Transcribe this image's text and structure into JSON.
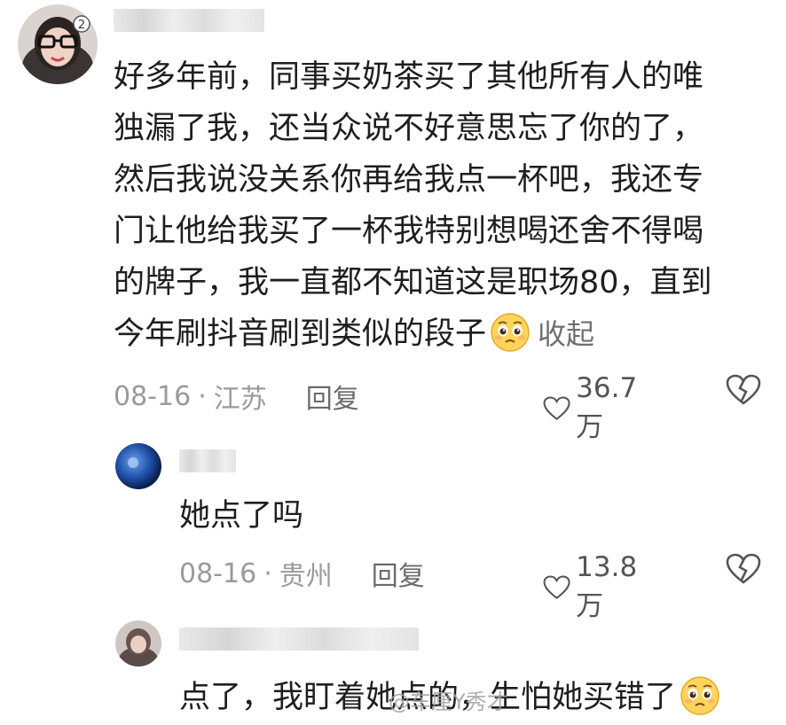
{
  "comments": [
    {
      "lines": [
        "好多年前，同事买奶茶买了其他所有人的唯",
        "独漏了我，还当众说不好意思忘了你的了，",
        "然后我说没关系你再给我点一杯吧，我还专",
        "门让他给我买了一杯我特别想喝还舍不得喝",
        "的牌子，我一直都不知道这是职场80，直到",
        "今年刷抖音刷到类似的段子"
      ],
      "emoji": "pleading-face-emoji",
      "collapse_label": "收起",
      "date": "08-16",
      "location": "江苏",
      "reply_label": "回复",
      "like_count": "36.7万"
    },
    {
      "lines": [
        "她点了吗"
      ],
      "date": "08-16",
      "location": "贵州",
      "reply_label": "回复",
      "like_count": "13.8万"
    },
    {
      "lines": [
        "点了，我盯着她点的，生怕她买错了"
      ],
      "emoji": "pleading-face-emoji"
    }
  ],
  "meta_separator": "·",
  "watermark": "@车厘Y秀才",
  "colors": {
    "text": "#1e1e1e",
    "meta": "#9a9a9a",
    "icon": "#555555"
  }
}
